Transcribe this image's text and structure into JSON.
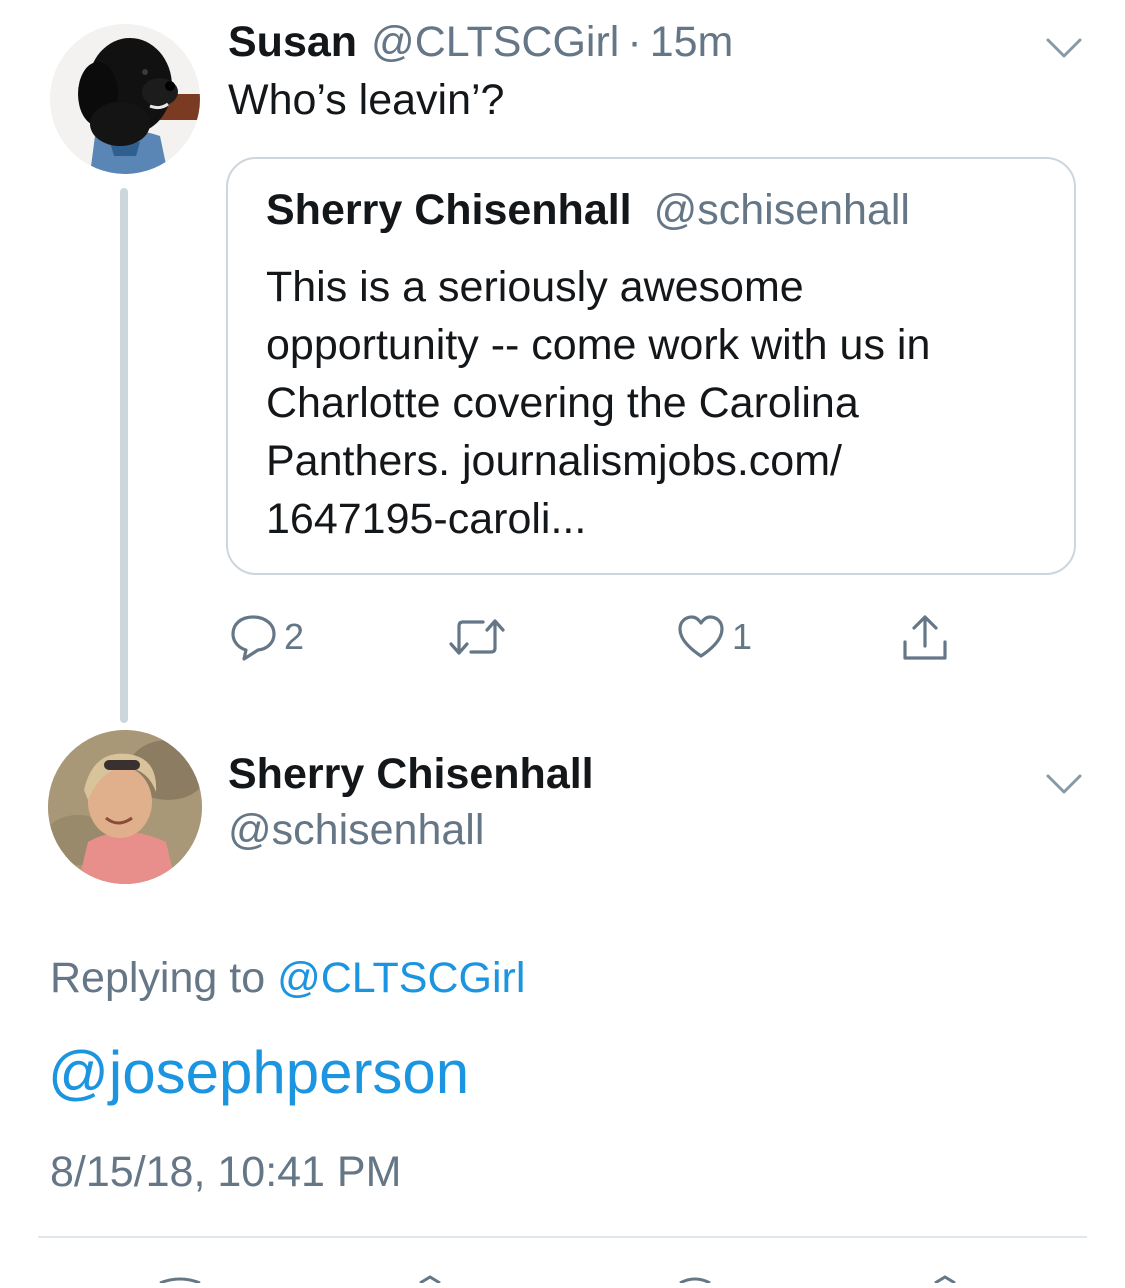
{
  "quoting_tweet": {
    "author_name": "Susan",
    "author_handle": "@CLTSCGirl",
    "separator": "·",
    "time": "15m",
    "text": "Who’s leavin’?",
    "menu_icon": "chevron-down-icon",
    "avatar": "dog-avatar"
  },
  "quoted_tweet": {
    "author_name": "Sherry Chisenhall",
    "author_handle": "@schisenhall",
    "text_lines": [
      "This is a seriously awesome",
      "opportunity -- come work with us in",
      "Charlotte covering the Carolina",
      "Panthers. journalismjobs.com/",
      "1647195-caroli..."
    ]
  },
  "actions": {
    "reply": {
      "icon": "reply-icon",
      "count": "2"
    },
    "retweet": {
      "icon": "retweet-icon",
      "count": ""
    },
    "like": {
      "icon": "heart-icon",
      "count": "1"
    },
    "share": {
      "icon": "share-icon"
    }
  },
  "focused_tweet": {
    "author_name": "Sherry Chisenhall",
    "author_handle": "@schisenhall",
    "replying_prefix": "Replying to",
    "replying_to": "@CLTSCGirl",
    "text": "@josephperson",
    "timestamp": "8/15/18, 10:41 PM",
    "menu_icon": "chevron-down-icon",
    "avatar": "woman-avatar"
  },
  "colors": {
    "text": "#14171a",
    "secondary": "#657786",
    "link": "#1b95e0",
    "border": "#ccd6dd"
  }
}
